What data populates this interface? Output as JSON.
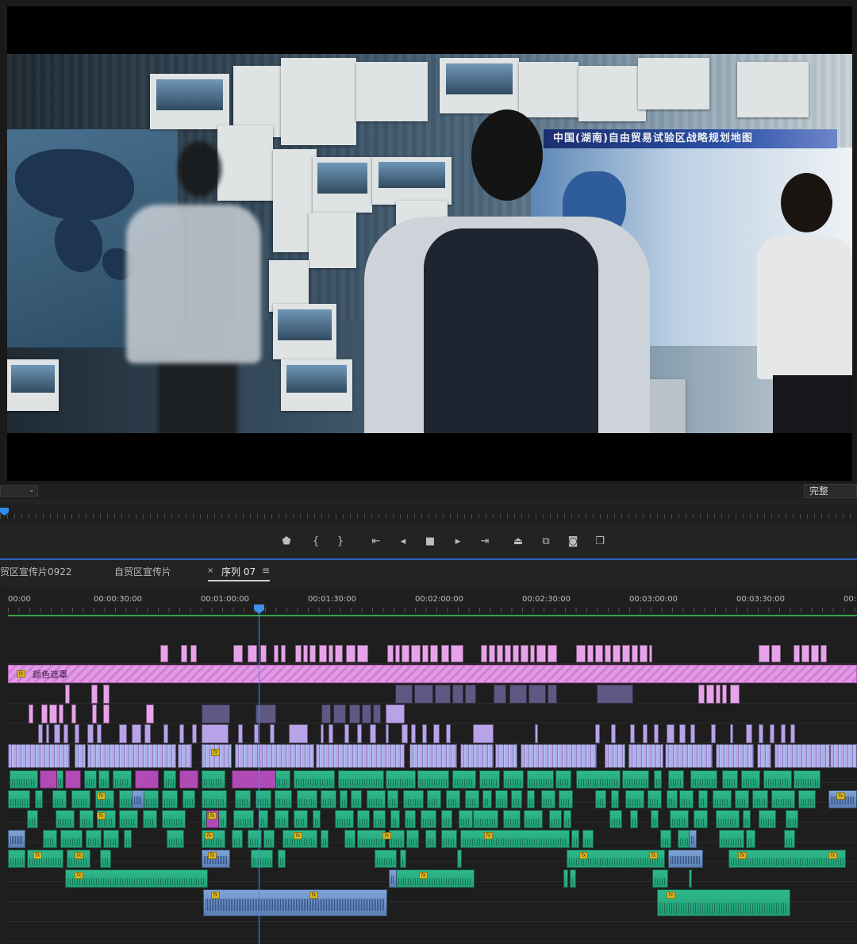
{
  "program_monitor": {
    "video_banner_text": "中国(湖南)自由贸易试验区战略规划地图",
    "resolution_dropdown": "完整",
    "zoom_dropdown": ""
  },
  "transport_controls": {
    "buttons": [
      "marker-icon",
      "mark-in-icon",
      "mark-out-icon",
      "go-to-in-icon",
      "step-back-icon",
      "stop-icon",
      "step-forward-icon",
      "go-to-out-icon",
      "lift-icon",
      "extract-icon",
      "camera-icon",
      "compare-icon"
    ]
  },
  "timeline": {
    "tabs": [
      {
        "label": "贸区宣传片0922",
        "active": false
      },
      {
        "label": "自贸区宣传片",
        "active": false
      },
      {
        "label": "序列 07",
        "active": true
      }
    ],
    "close_glyph": "×",
    "menu_glyph": "≡",
    "timecodes": [
      "00:00",
      "00:00:30:00",
      "00:01:00:00",
      "00:01:30:00",
      "00:02:00:00",
      "00:02:30:00",
      "00:03:00:00",
      "00:03:30:00",
      "00:"
    ],
    "adjustment_layer_label": "颜色遮罩",
    "fx_badge": "fx"
  },
  "colors": {
    "accent_blue": "#2b62c3",
    "playhead": "#3f8ff0",
    "clip_pink": "#e7a3e9",
    "clip_lavender": "#b8a2e8",
    "clip_teal_audio": "#2fb98a",
    "clip_blue_audio": "#7fa4d6",
    "work_area": "#35a34a"
  }
}
